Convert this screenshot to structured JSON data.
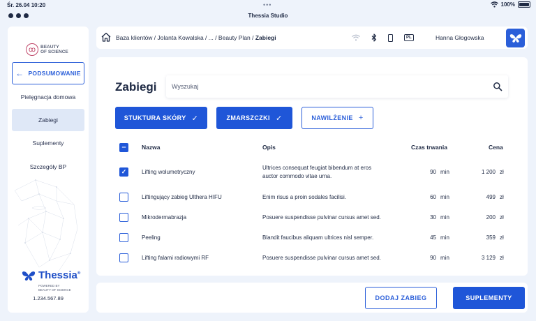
{
  "status": {
    "time": "Śr. 26.04 10:20",
    "battery": "100%",
    "battery_level": 1.0
  },
  "window": {
    "title": "Thessia Studio"
  },
  "sidebar": {
    "brand": [
      "BEAUTY",
      "OF SCIENCE"
    ],
    "back_label": "PODSUMOWANIE",
    "items": [
      {
        "label": "Pielęgnacja domowa",
        "active": false
      },
      {
        "label": "Zabiegi",
        "active": true
      },
      {
        "label": "Suplementy",
        "active": false
      },
      {
        "label": "Szczegóły BP",
        "active": false
      }
    ],
    "logo_name": "Thessia",
    "logo_reg": "®",
    "powered_by": [
      "POWERED BY",
      "BEAUTY OF SCIENCE"
    ],
    "phone": "1.234.567.89"
  },
  "header": {
    "breadcrumb_path": "Baza klientów / Jolanta Kowalska / ... / Beauty Plan / ",
    "breadcrumb_current": "Zabiegi",
    "language": "PL",
    "user": "Hanna Głogowska"
  },
  "main": {
    "title": "Zabiegi",
    "search_placeholder": "Wyszukaj",
    "filters": [
      {
        "label": "STUKTURA SKÓRY",
        "state": "selected",
        "symbol": "✓"
      },
      {
        "label": "ZMARSZCZKI",
        "state": "selected",
        "symbol": "✓"
      },
      {
        "label": "NAWILŻENIE",
        "state": "add",
        "symbol": "+"
      }
    ],
    "columns": {
      "name": "Nazwa",
      "desc": "Opis",
      "duration": "Czas trwania",
      "price": "Cena"
    },
    "rows": [
      {
        "checked": true,
        "name": "Lifting wolumetryczny",
        "desc_lines": [
          "Ultrices consequat feugiat bibendum at eros",
          "auctor commodo vitae urna."
        ],
        "duration": "90",
        "unit": "min",
        "price": "1 200",
        "currency": "zł"
      },
      {
        "checked": false,
        "name": "Liftingujący zabieg Ulthera HIFU",
        "desc_lines": [
          "Enim risus a proin sodales facilisi."
        ],
        "duration": "60",
        "unit": "min",
        "price": "499",
        "currency": "zł"
      },
      {
        "checked": false,
        "name": "Mikrodermabrazja",
        "desc_lines": [
          "Posuere suspendisse pulvinar cursus amet sed."
        ],
        "duration": "30",
        "unit": "min",
        "price": "200",
        "currency": "zł"
      },
      {
        "checked": false,
        "name": "Peeling",
        "desc_lines": [
          "Blandit faucibus aliquam ultrices nisl semper."
        ],
        "duration": "45",
        "unit": "min",
        "price": "359",
        "currency": "zł"
      },
      {
        "checked": false,
        "name": "Lifting falami radiowymi RF",
        "desc_lines": [
          "Posuere suspendisse pulvinar cursus amet sed."
        ],
        "duration": "90",
        "unit": "min",
        "price": "3 129",
        "currency": "zł"
      }
    ]
  },
  "footer": {
    "add_label": "DODAJ ZABIEG",
    "next_label": "SUPLEMENTY"
  },
  "icons": [
    "wifi-icon",
    "bluetooth-icon",
    "phone-icon",
    "language-badge",
    "home-icon",
    "search-icon",
    "check-icon",
    "plus-icon",
    "arrow-left-icon",
    "butterfly-logo-icon"
  ],
  "colors": {
    "accent": "#1f56d8",
    "text": "#1f2a44",
    "background": "#eef3fb",
    "brand_pink": "#c0486a"
  }
}
